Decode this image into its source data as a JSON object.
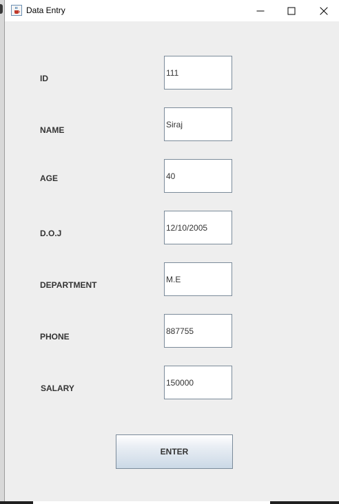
{
  "window": {
    "title": "Data Entry",
    "icon": "java-cup-icon"
  },
  "form": {
    "fields": [
      {
        "label": "ID",
        "value": "111"
      },
      {
        "label": "NAME",
        "value": "Siraj"
      },
      {
        "label": "AGE",
        "value": "40"
      },
      {
        "label": "D.O.J",
        "value": "12/10/2005"
      },
      {
        "label": "DEPARTMENT",
        "value": "M.E"
      },
      {
        "label": "PHONE",
        "value": "887755"
      },
      {
        "label": "SALARY",
        "value": "150000"
      }
    ],
    "submit_label": "ENTER"
  },
  "colors": {
    "window_bg": "#eeeeee",
    "titlebar_bg": "#ffffff",
    "field_border": "#7a8a99",
    "button_gradient_bottom": "#cbd9e6"
  }
}
